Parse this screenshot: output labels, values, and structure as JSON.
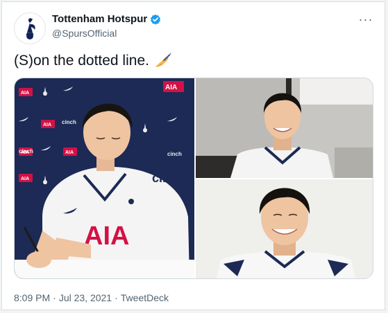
{
  "tweet": {
    "author": {
      "display_name": "Tottenham Hotspur",
      "handle": "@SpursOfficial",
      "verified": true,
      "avatar_icon": "spurs-cockerel-logo"
    },
    "text": "(S)on the dotted line.",
    "emoji_icon": "writing-hand-emoji",
    "more_icon": "more-options-icon",
    "more_label": "···",
    "time": "8:09 PM",
    "separator": "·",
    "date": "Jul 23, 2021",
    "source": "TweetDeck",
    "media": {
      "photos": [
        {
          "id": "signing-photo",
          "description_icon": "photo"
        },
        {
          "id": "smiling-office-photo",
          "description_icon": "photo"
        },
        {
          "id": "smiling-close-photo",
          "description_icon": "photo"
        }
      ],
      "sponsor_text": "AIA",
      "kit_text": "cinch"
    }
  },
  "colors": {
    "brand_navy": "#132257",
    "verified_blue": "#1d9bf0",
    "text_primary": "#0f1419",
    "text_secondary": "#536471",
    "backdrop_navy": "#1c2a55",
    "aia_red": "#d31145"
  }
}
